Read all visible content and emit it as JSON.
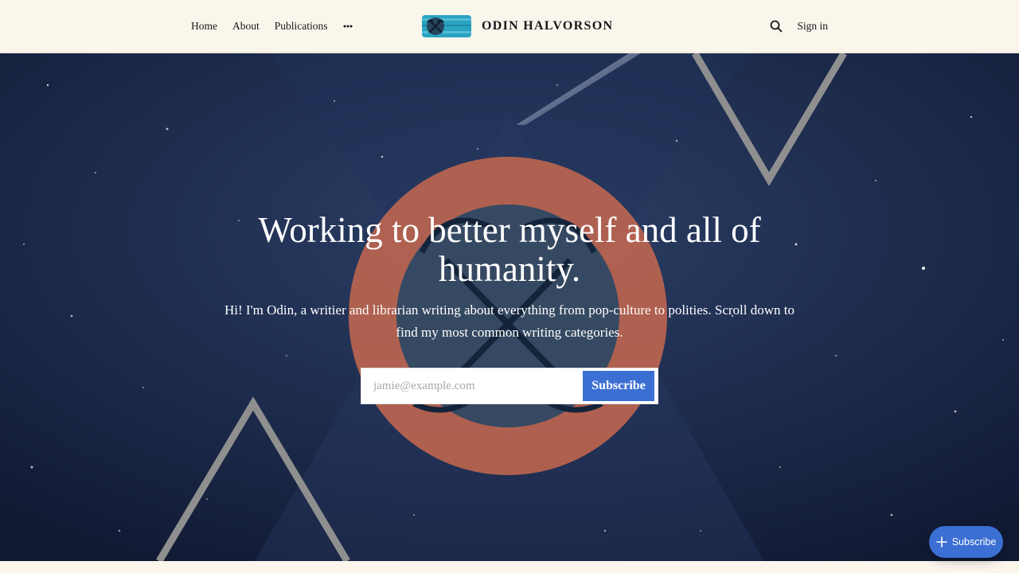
{
  "nav": {
    "home": "Home",
    "about": "About",
    "publications": "Publications",
    "more_icon": "more-horizontal-icon"
  },
  "brand": {
    "name": "ODIN HALVORSON",
    "logo_icon": "crossed-feathers-logo"
  },
  "nav_right": {
    "search_icon": "search-icon",
    "signin": "Sign in"
  },
  "hero": {
    "title": "Working to better myself and all of humanity.",
    "description": "Hi! I'm Odin, a writier and librarian writing about everything from pop-culture to polities. Scroll down to find my most common writing categories."
  },
  "form": {
    "email_placeholder": "jamie@example.com",
    "email_value": "",
    "button_label": "Subscribe"
  },
  "portal": {
    "label": "Subscribe",
    "icon": "plus-icon"
  },
  "colors": {
    "accent": "#3b6fd3",
    "header_bg": "#fbf6ec",
    "hero_bg": "#1c2a4a",
    "circle": "#c8694f",
    "text": "#15171a"
  }
}
